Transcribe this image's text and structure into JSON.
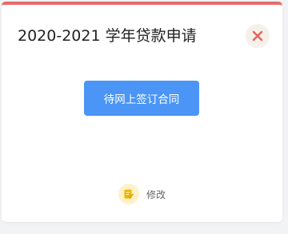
{
  "dialog": {
    "title": "2020-2021 学年贷款申请",
    "primary_button_label": "待网上签订合同",
    "edit_label": "修改"
  },
  "icons": {
    "close": "close-icon",
    "edit": "edit-icon"
  },
  "colors": {
    "accent_top_border": "#e96a6a",
    "close_icon": "#e8655f",
    "primary_button": "#4a95f5",
    "edit_icon": "#f0b400"
  }
}
